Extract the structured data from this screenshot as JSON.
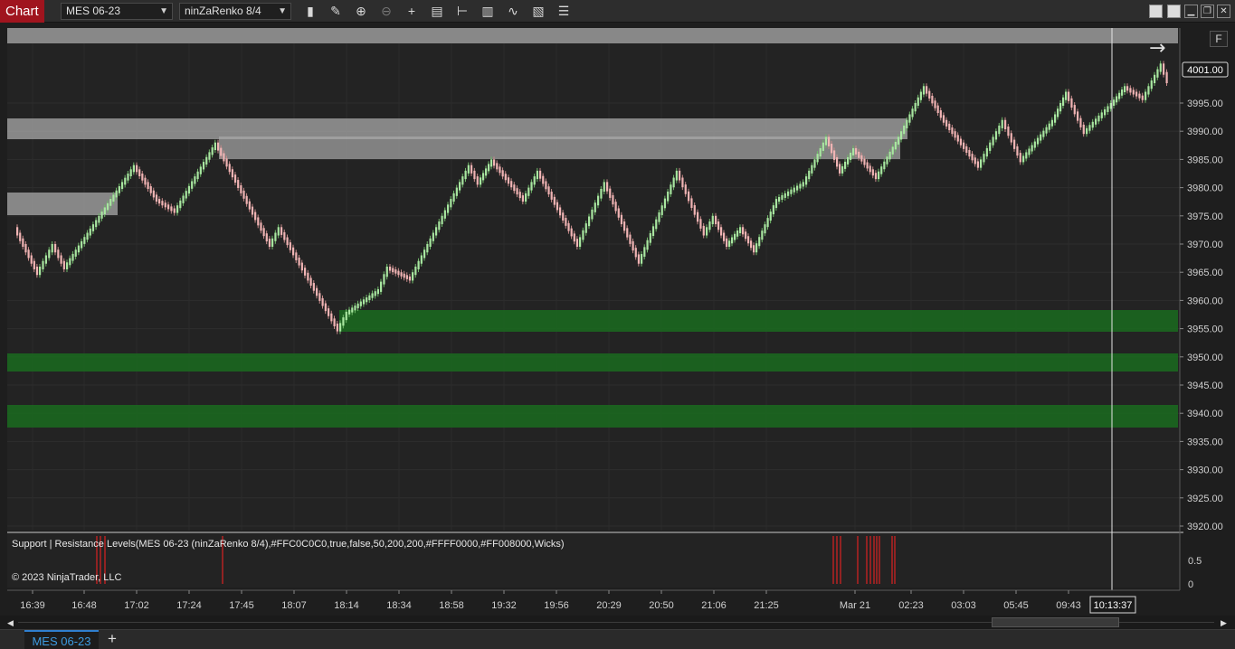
{
  "app": {
    "title": "Chart"
  },
  "toolbar": {
    "instrument": "MES 06-23",
    "bar_type": "ninZaRenko 8/4",
    "icons": [
      "bar-style-icon",
      "draw-pencil-icon",
      "zoom-in-icon",
      "zoom-out-icon",
      "crosshair-icon",
      "data-box-icon",
      "chart-trader-icon",
      "indicators-icon",
      "strategies-icon",
      "properties-icon",
      "menu-list-icon"
    ]
  },
  "window_controls": [
    "minimize-icon",
    "restore-icon",
    "maximize-icon",
    "close-icon"
  ],
  "chart": {
    "f_label": "F",
    "current_price": "4001.00",
    "price_labels": [
      "3995.00",
      "3990.00",
      "3985.00",
      "3980.00",
      "3975.00",
      "3970.00",
      "3965.00",
      "3960.00",
      "3955.00",
      "3950.00",
      "3945.00",
      "3940.00",
      "3935.00",
      "3930.00",
      "3925.00",
      "3920.00"
    ],
    "indicator_label": "Support | Resistance Levels(MES 06-23 (ninZaRenko 8/4),#FFC0C0C0,true,false,50,200,200,#FFFF0000,#FF008000,Wicks)",
    "copyright": "© 2023 NinjaTrader, LLC",
    "indicator_axis": [
      "0.5",
      "0"
    ],
    "time_labels": [
      "16:39",
      "16:48",
      "17:02",
      "17:24",
      "17:45",
      "18:07",
      "18:14",
      "18:34",
      "18:58",
      "19:32",
      "19:56",
      "20:29",
      "20:50",
      "21:06",
      "21:25",
      "Mar 21",
      "02:23",
      "03:03",
      "05:45",
      "09:43"
    ],
    "cursor_time": "10:13:37",
    "colors": {
      "up_candle": "#a8e6a0",
      "down_candle": "#f0b4b4",
      "resistance_zone": "#c0c0c0",
      "support_zone": "#1a6b1e",
      "signal": "#ff2020",
      "cursor_line": "#e6e6e6"
    }
  },
  "tabs": {
    "active": "MES 06-23",
    "add_label": "+"
  }
}
